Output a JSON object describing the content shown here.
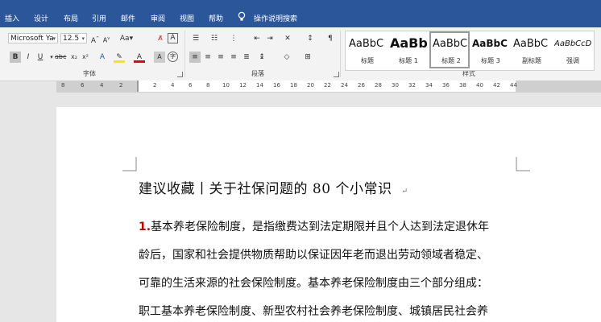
{
  "tabs": [
    "插入",
    "设计",
    "布局",
    "引用",
    "邮件",
    "审阅",
    "视图",
    "帮助"
  ],
  "tell_me": "操作说明搜索",
  "font": {
    "name": "Microsoft Ya",
    "size": "12.5"
  },
  "groups": {
    "font": "字体",
    "paragraph": "段落",
    "styles": "样式"
  },
  "styles": [
    {
      "sample": "AaBbC",
      "name": "标题"
    },
    {
      "sample": "AaBb",
      "name": "标题 1"
    },
    {
      "sample": "AaBbC",
      "name": "标题 2"
    },
    {
      "sample": "AaBbC",
      "name": "标题 3"
    },
    {
      "sample": "AaBbC",
      "name": "副标题"
    },
    {
      "sample": "AaBbCcD",
      "name": "强调"
    }
  ],
  "ruler_numbers": [
    "8",
    "6",
    "4",
    "2",
    "2",
    "4",
    "6",
    "8",
    "10",
    "12",
    "14",
    "16",
    "18",
    "20",
    "22",
    "24",
    "26",
    "28",
    "30",
    "32",
    "34",
    "36",
    "38",
    "40",
    "42",
    "44"
  ],
  "document": {
    "title": "建议收藏丨关于社保问题的 80 个小常识",
    "number": "1.",
    "lines": [
      "基本养老保险制度，是指缴费达到法定期限并且个人达到法定退休年",
      "龄后，国家和社会提供物质帮助以保证因年老而退出劳动领域者稳定、",
      "可靠的生活来源的社会保险制度。基本养老保险制度由三个部分组成：",
      "职工基本养老保险制度、新型农村社会养老保险制度、城镇居民社会养"
    ]
  },
  "colors": {
    "ribbon": "#2b579a",
    "number": "#c00000"
  }
}
